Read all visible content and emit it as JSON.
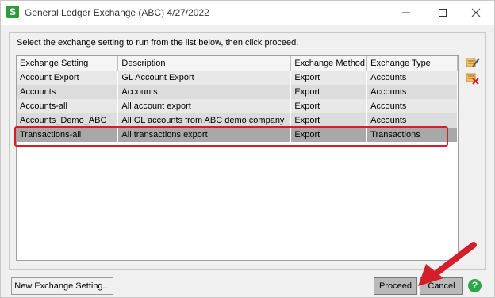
{
  "window": {
    "title": "General Ledger Exchange (ABC) 4/27/2022",
    "icon_letter": "S",
    "controls": [
      "minimize-icon",
      "maximize-icon",
      "close-icon"
    ]
  },
  "instructions": "Select the exchange setting to run from the list below, then click proceed.",
  "table": {
    "headers": [
      "Exchange Setting",
      "Description",
      "Exchange Method",
      "Exchange Type"
    ],
    "rows": [
      [
        "Account Export",
        "GL Account Export",
        "Export",
        "Accounts"
      ],
      [
        "Accounts",
        "Accounts",
        "Export",
        "Accounts"
      ],
      [
        "Accounts-all",
        "All account export",
        "Export",
        "Accounts"
      ],
      [
        "Accounts_Demo_ABC",
        "All GL accounts from ABC demo company",
        "Export",
        "Accounts"
      ],
      [
        "Transactions-all",
        "All transactions export",
        "Export",
        "Transactions"
      ]
    ],
    "selected_row": "Transactions-all"
  },
  "side_icons": [
    "edit-setting-icon",
    "delete-setting-icon"
  ],
  "buttons": {
    "new_setting": "New Exchange Setting...",
    "proceed": "Proceed",
    "cancel": "Cancel",
    "help": "?"
  },
  "colors": {
    "accent_red": "#d21f2b",
    "brand_green": "#2e9b3a"
  }
}
